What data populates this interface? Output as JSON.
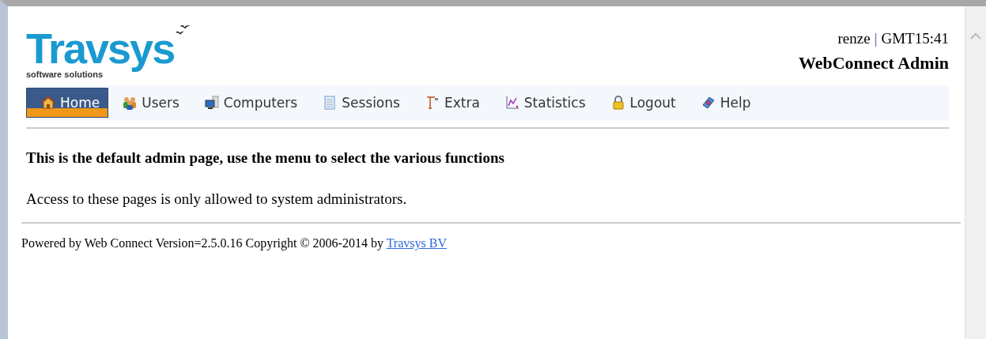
{
  "logo": {
    "name": "Travsys",
    "tagline": "software solutions"
  },
  "header": {
    "user": "renze",
    "separator": "|",
    "time": "GMT15:41",
    "title": "WebConnect Admin"
  },
  "nav": [
    {
      "label": "Home",
      "kind": "home",
      "selected": true
    },
    {
      "label": "Users",
      "kind": "users",
      "selected": false
    },
    {
      "label": "Computers",
      "kind": "computer",
      "selected": false
    },
    {
      "label": "Sessions",
      "kind": "list",
      "selected": false
    },
    {
      "label": "Extra",
      "kind": "crane",
      "selected": false
    },
    {
      "label": "Statistics",
      "kind": "chart",
      "selected": false
    },
    {
      "label": "Logout",
      "kind": "lock",
      "selected": false
    },
    {
      "label": "Help",
      "kind": "book",
      "selected": false
    }
  ],
  "content": {
    "heading": "This is the default admin page, use the menu to select the various functions",
    "text": "Access to these pages is only allowed to system administrators."
  },
  "footer": {
    "text": "Powered by Web Connect Version=2.5.0.16 Copyright © 2006-2014 by",
    "link": "Travsys BV"
  }
}
